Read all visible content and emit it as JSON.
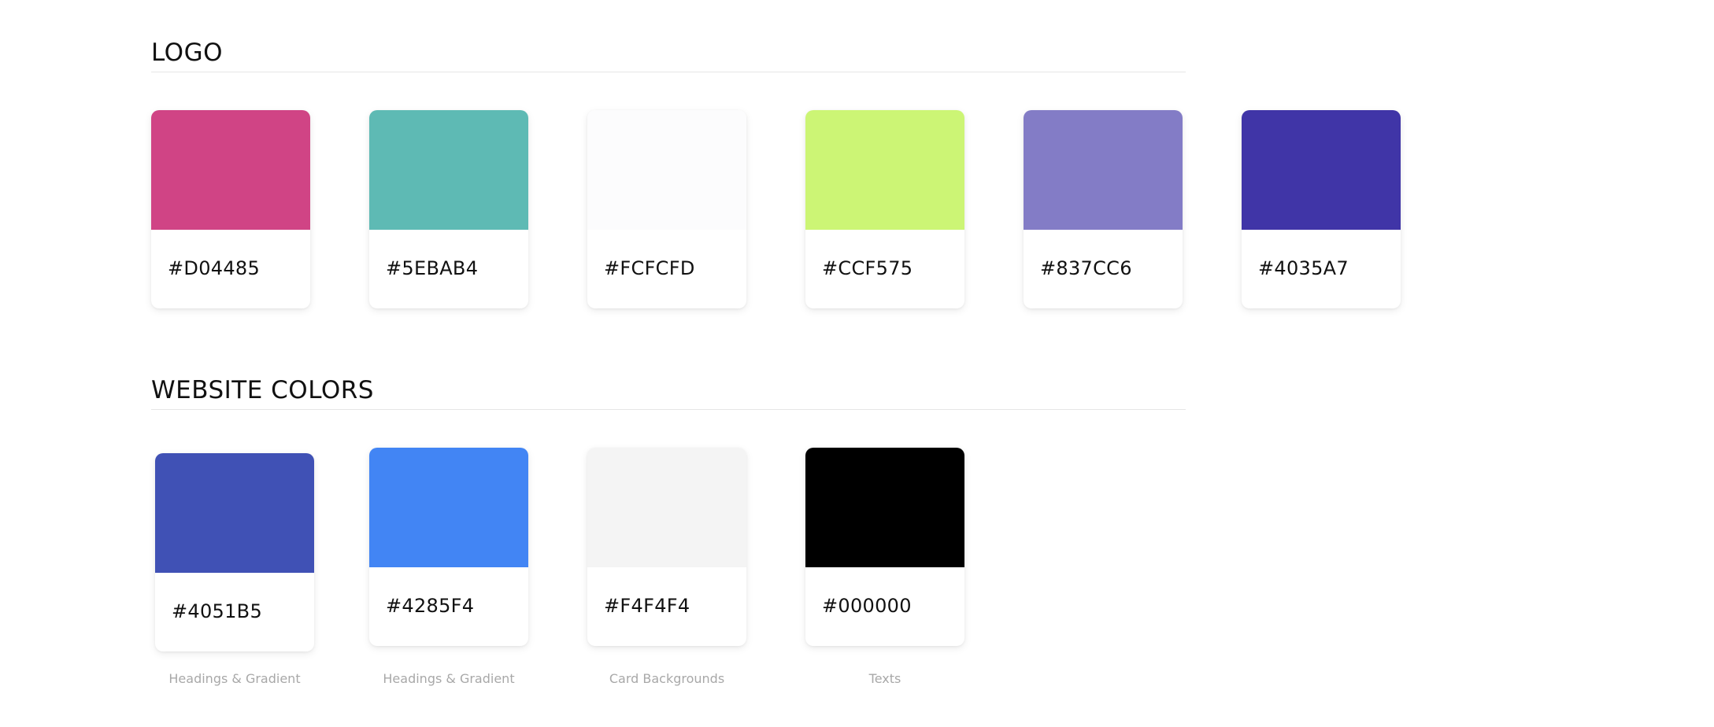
{
  "logo_section": {
    "title": "LOGO",
    "swatches": [
      {
        "hex": "#D04485",
        "color": "#D04485"
      },
      {
        "hex": "#5EBAB4",
        "color": "#5EBAB4"
      },
      {
        "hex": "#FCFCFD",
        "color": "#FCFCFD"
      },
      {
        "hex": "#CCF575",
        "color": "#CCF575"
      },
      {
        "hex": "#837CC6",
        "color": "#837CC6"
      },
      {
        "hex": "#4035A7",
        "color": "#4035A7"
      }
    ]
  },
  "website_section": {
    "title": "WEBSITE COLORS",
    "swatches": [
      {
        "hex": "#4051B5",
        "color": "#4051B5",
        "caption": "Headings & Gradient"
      },
      {
        "hex": "#4285F4",
        "color": "#4285F4",
        "caption": "Headings & Gradient"
      },
      {
        "hex": "#F4F4F4",
        "color": "#F4F4F4",
        "caption": "Card Backgrounds"
      },
      {
        "hex": "#000000",
        "color": "#000000",
        "caption": "Texts"
      }
    ]
  }
}
